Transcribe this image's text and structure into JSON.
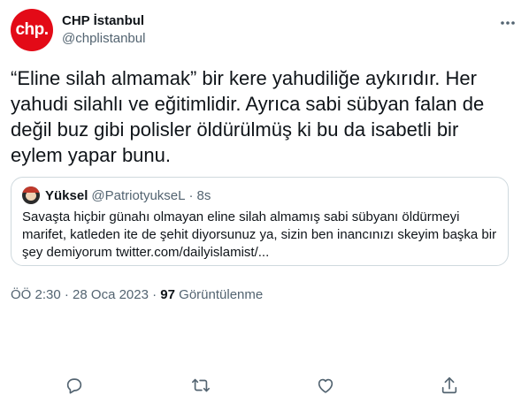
{
  "author": {
    "avatar_text": "chp.",
    "display_name": "CHP İstanbul",
    "handle": "@chplistanbul"
  },
  "tweet_text": "“Eline silah almamak” bir kere yahudiliğe aykırıdır. Her yahudi silahlı ve eğitimlidir. Ayrıca sabi sübyan falan de değil buz gibi polisler öldürülmüş ki bu da isabetli bir eylem yapar bunu.",
  "quote": {
    "name": "Yüksel",
    "handle": "@PatriotyukseL",
    "separator": "·",
    "time": "8s",
    "text": "Savaşta hiçbir günahı olmayan eline silah almamış sabi sübyanı öldürmeyi marifet, katleden ite de şehit diyorsunuz ya, sizin ben inancınızı skeyim başka bir şey demiyorum twitter.com/dailyislamist/..."
  },
  "meta": {
    "time": "ÖÖ 2:30",
    "sep1": "·",
    "date": "28 Oca 2023",
    "sep2": "·",
    "views_count": "97",
    "views_label": "Görüntülenme"
  },
  "colors": {
    "brand_red": "#e30a17",
    "text": "#0f1419",
    "secondary": "#536471",
    "border": "#cfd9de"
  },
  "icons": [
    "more-icon",
    "reply-icon",
    "retweet-icon",
    "like-icon",
    "share-icon"
  ]
}
